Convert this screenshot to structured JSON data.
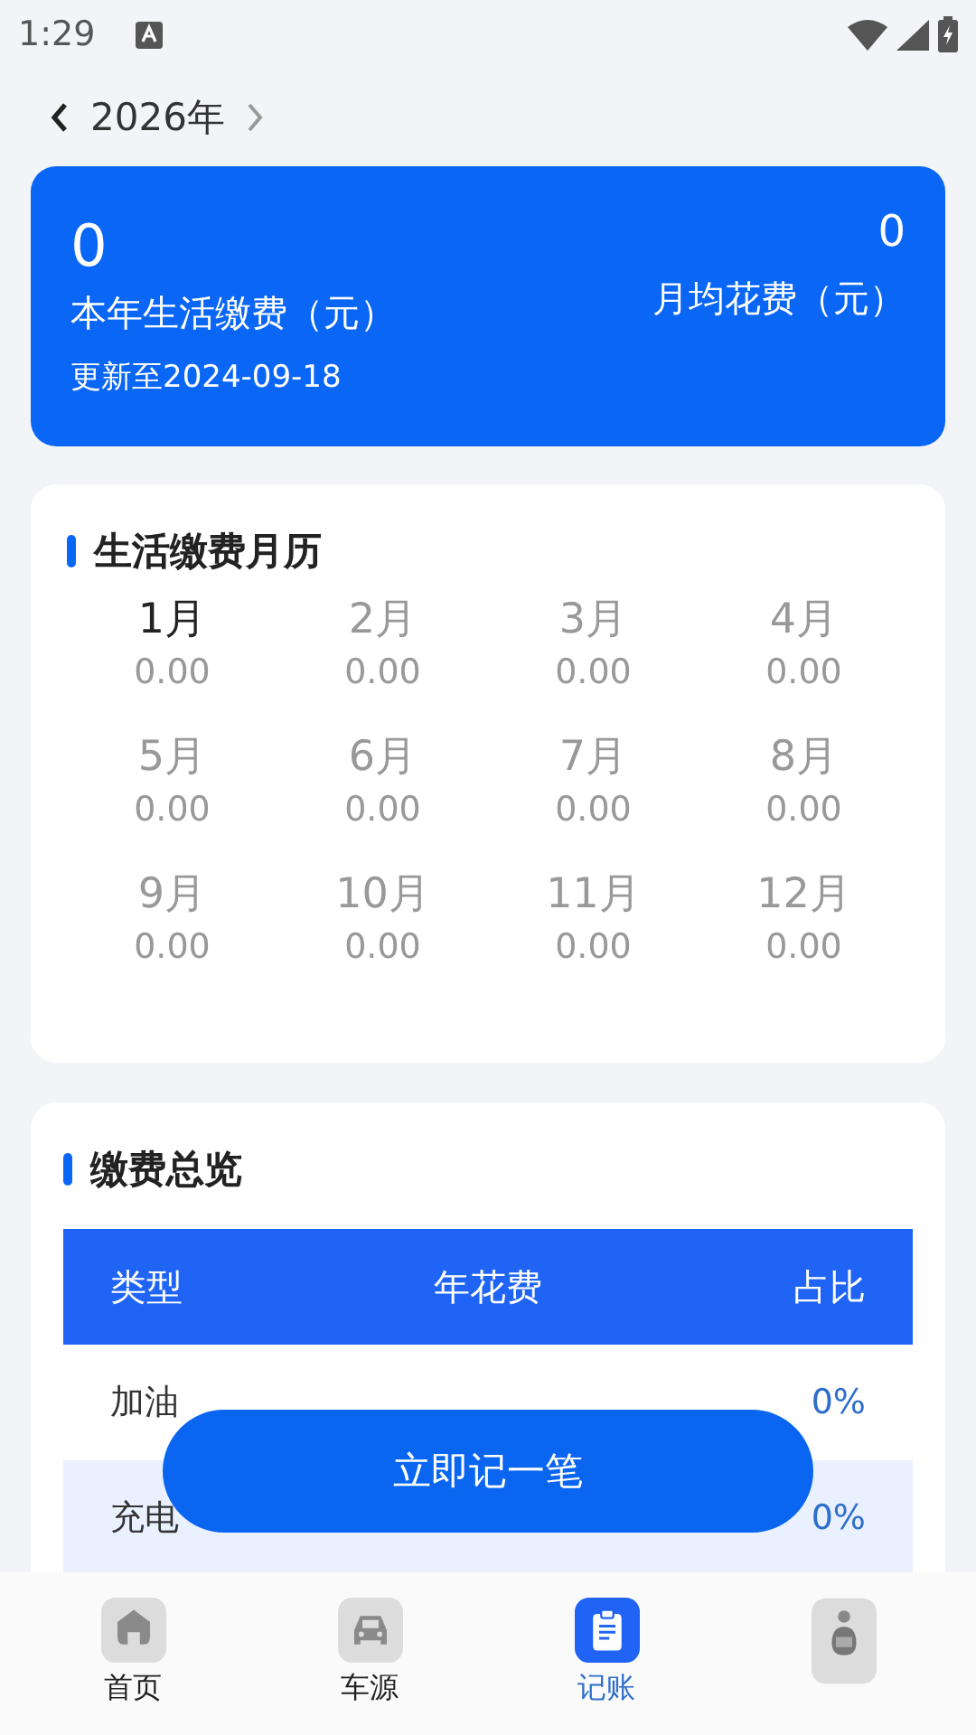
{
  "status_bar": {
    "time": "1:29"
  },
  "year_nav": {
    "year": "2026年"
  },
  "summary": {
    "total": "0",
    "total_label": "本年生活缴费（元）",
    "updated": "更新至2024-09-18",
    "monthly_avg": "0",
    "monthly_avg_label": "月均花费（元）"
  },
  "calendar": {
    "title": "生活缴费月历",
    "months": [
      {
        "label": "1月",
        "amount": "0.00",
        "selected": true
      },
      {
        "label": "2月",
        "amount": "0.00",
        "selected": false
      },
      {
        "label": "3月",
        "amount": "0.00",
        "selected": false
      },
      {
        "label": "4月",
        "amount": "0.00",
        "selected": false
      },
      {
        "label": "5月",
        "amount": "0.00",
        "selected": false
      },
      {
        "label": "6月",
        "amount": "0.00",
        "selected": false
      },
      {
        "label": "7月",
        "amount": "0.00",
        "selected": false
      },
      {
        "label": "8月",
        "amount": "0.00",
        "selected": false
      },
      {
        "label": "9月",
        "amount": "0.00",
        "selected": false
      },
      {
        "label": "10月",
        "amount": "0.00",
        "selected": false
      },
      {
        "label": "11月",
        "amount": "0.00",
        "selected": false
      },
      {
        "label": "12月",
        "amount": "0.00",
        "selected": false
      }
    ]
  },
  "overview": {
    "title": "缴费总览",
    "table": {
      "columns": [
        "类型",
        "年花费",
        "占比"
      ],
      "rows": [
        {
          "type": "加油",
          "share": "0%"
        },
        {
          "type": "充电",
          "share": "0%"
        }
      ]
    }
  },
  "record_button": {
    "label": "立即记一笔"
  },
  "bottom_nav": [
    {
      "kind": "home",
      "label": "首页",
      "selected": false
    },
    {
      "kind": "car",
      "label": "车源",
      "selected": false
    },
    {
      "kind": "clipboard",
      "label": "记账",
      "selected": true
    },
    {
      "kind": "profile",
      "selected": false
    }
  ]
}
